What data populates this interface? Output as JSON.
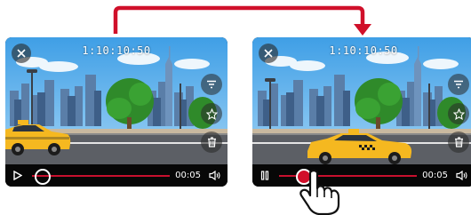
{
  "colors": {
    "arrow": "#d0102a",
    "track": "#c8102e",
    "knob_active": "#d10f2a",
    "taxi": "#f5b820",
    "sky": "#5fb4ee"
  },
  "before": {
    "timecode": "1:10:10:50",
    "duration": "00:05",
    "play_state": "paused",
    "progress": 0.08,
    "icons": [
      "close-icon",
      "filter-icon",
      "star-icon",
      "trash-icon",
      "play-icon",
      "volume-icon"
    ]
  },
  "after": {
    "timecode": "1:10:10:50",
    "duration": "00:05",
    "play_state": "playing",
    "progress": 0.18,
    "icons": [
      "close-icon",
      "filter-icon",
      "star-icon",
      "trash-icon",
      "pause-icon",
      "volume-icon",
      "hand-cursor-icon"
    ]
  }
}
